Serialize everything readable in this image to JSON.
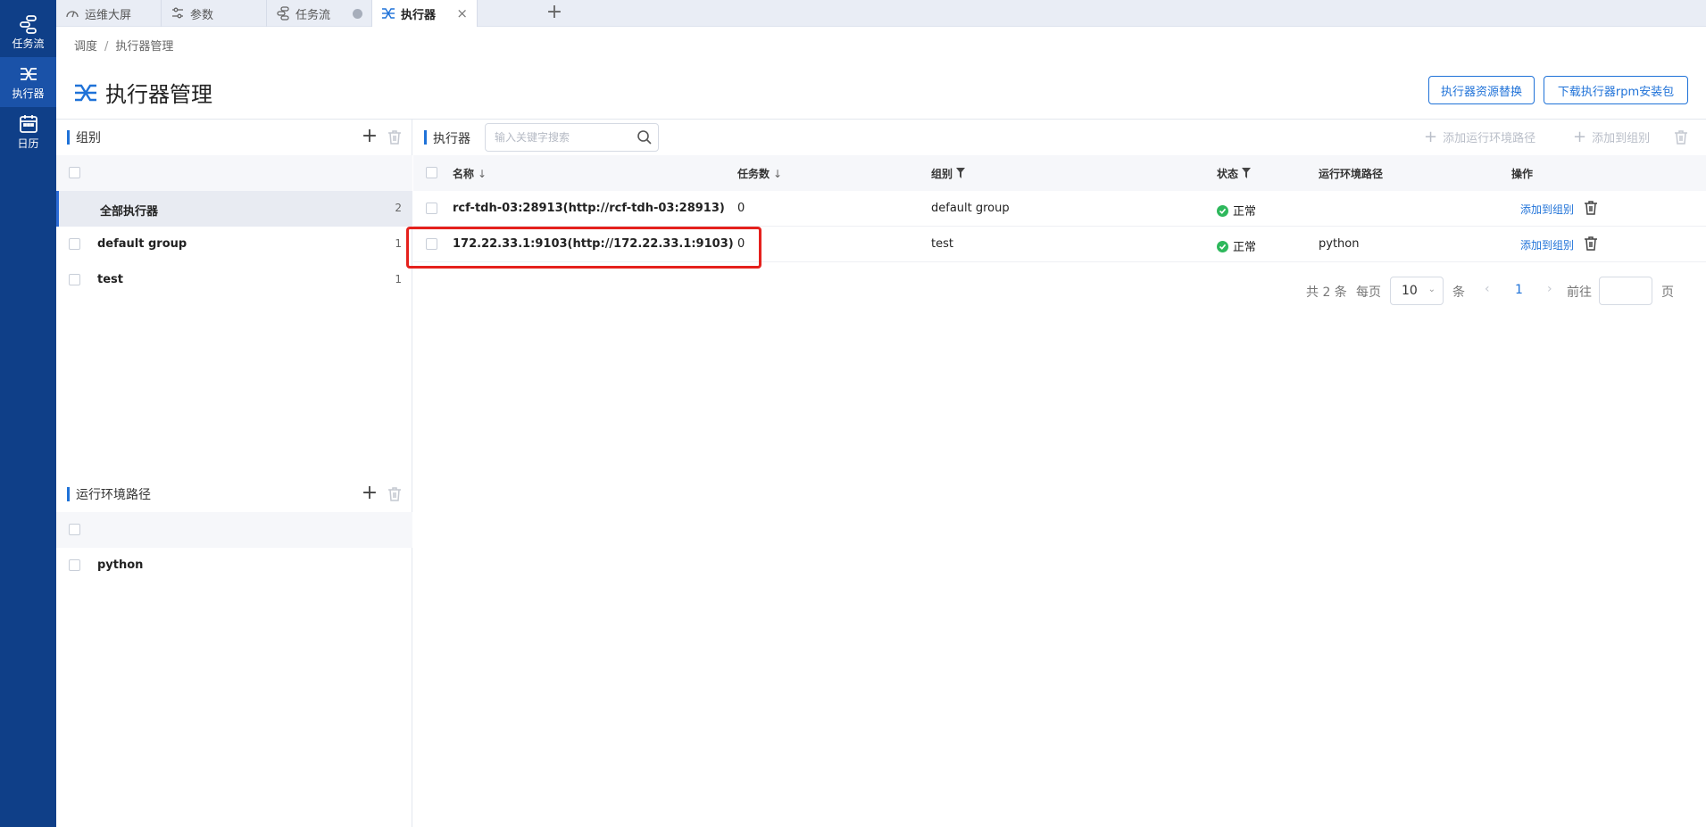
{
  "nav": {
    "items": [
      {
        "label": "任务流",
        "icon": "workflow-icon"
      },
      {
        "label": "执行器",
        "icon": "executor-icon"
      },
      {
        "label": "日历",
        "icon": "calendar-icon"
      }
    ]
  },
  "tabs": [
    {
      "label": "运维大屏",
      "icon": "gauge-icon"
    },
    {
      "label": "参数",
      "icon": "sliders-icon"
    },
    {
      "label": "任务流",
      "icon": "workflow-icon"
    },
    {
      "label": "执行器",
      "icon": "executor-icon"
    }
  ],
  "tab_close": "×",
  "tab_add": "+",
  "breadcrumb": {
    "items": [
      "调度",
      "执行器管理"
    ],
    "separator": "/"
  },
  "page": {
    "title": "执行器管理"
  },
  "header_buttons": {
    "replace_resource": "执行器资源替换",
    "download_rpm": "下载执行器rpm安装包"
  },
  "groups_panel": {
    "title": "组别",
    "add": "+",
    "items": [
      {
        "label": "全部执行器",
        "count": "2"
      },
      {
        "label": "default group",
        "count": "1"
      },
      {
        "label": "test",
        "count": "1"
      }
    ]
  },
  "env_panel": {
    "title": "运行环境路径",
    "add": "+",
    "items": [
      {
        "label": "python"
      }
    ]
  },
  "executors": {
    "title": "执行器",
    "search_placeholder": "输入关键字搜索",
    "add_env_path": "添加运行环境路径",
    "add_to_group": "添加到组别",
    "plus": "+",
    "columns": {
      "name": "名称",
      "tasks": "任务数",
      "group": "组别",
      "status": "状态",
      "env_path": "运行环境路径",
      "actions": "操作"
    },
    "sort_arrow": "↓",
    "rows": [
      {
        "name": "rcf-tdh-03:28913(http://rcf-tdh-03:28913)",
        "tasks": "0",
        "group": "default group",
        "status": "正常",
        "env_path": "",
        "action": "添加到组别"
      },
      {
        "name": "172.22.33.1:9103(http://172.22.33.1:9103)",
        "tasks": "0",
        "group": "test",
        "status": "正常",
        "env_path": "python",
        "action": "添加到组别"
      }
    ]
  },
  "pagination": {
    "total": "共 2 条",
    "per_page_label": "每页",
    "per_page": "10",
    "unit": "条",
    "current_page": "1",
    "prev": "‹",
    "next": "›",
    "chev": "⌄",
    "goto": "前往",
    "page_suffix": "页"
  },
  "colors": {
    "nav_bg": "#0f3f88",
    "accent": "#1f72d8",
    "status_ok": "#2eb85c",
    "highlight": "#e5211d"
  }
}
